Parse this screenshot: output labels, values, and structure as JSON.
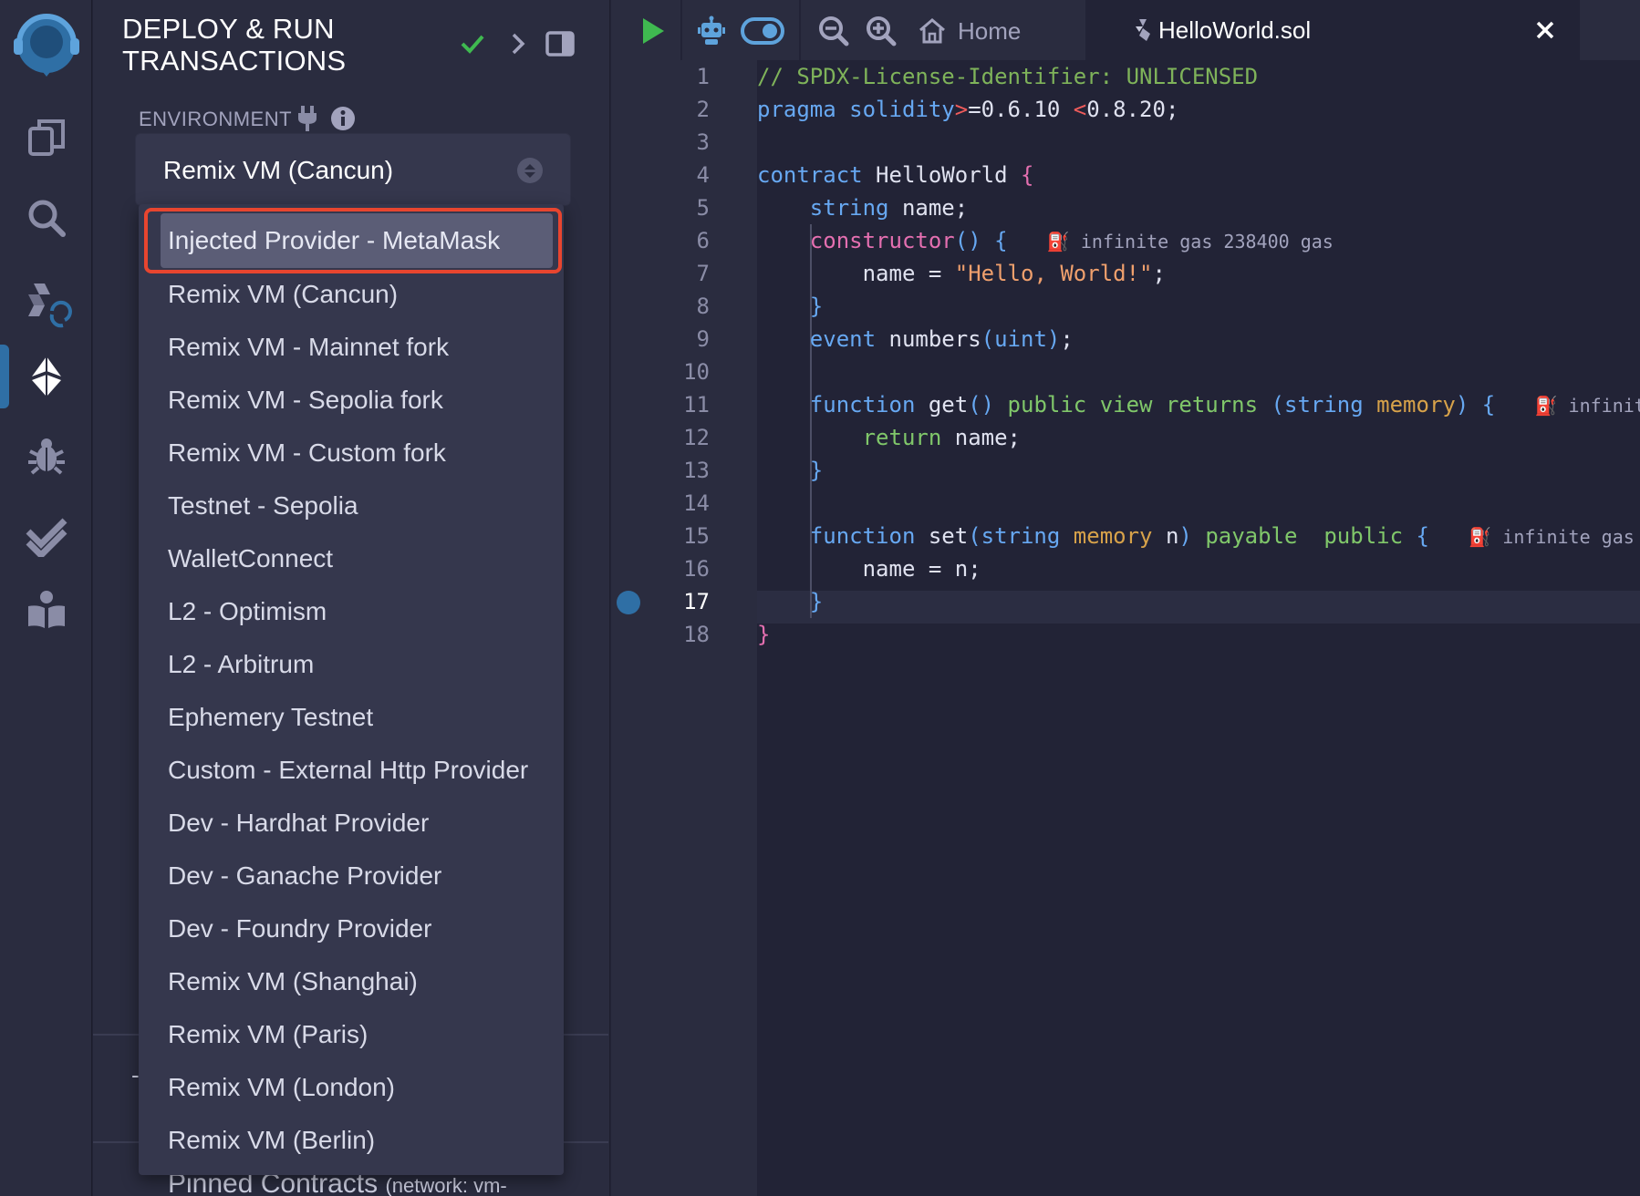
{
  "panel": {
    "title": "DEPLOY & RUN TRANSACTIONS",
    "environment_label": "ENVIRONMENT",
    "selected_environment": "Remix VM (Cancun)",
    "dash_text": "-",
    "pinned_label": "Pinned Contracts",
    "pinned_network": "(network: vm-"
  },
  "dropdown": {
    "options": [
      "Injected Provider - MetaMask",
      "Remix VM (Cancun)",
      "Remix VM - Mainnet fork",
      "Remix VM - Sepolia fork",
      "Remix VM - Custom fork",
      "Testnet - Sepolia",
      "WalletConnect",
      "L2 - Optimism",
      "L2 - Arbitrum",
      "Ephemery Testnet",
      "Custom - External Http Provider",
      "Dev - Hardhat Provider",
      "Dev - Ganache Provider",
      "Dev - Foundry Provider",
      "Remix VM (Shanghai)",
      "Remix VM (Paris)",
      "Remix VM (London)",
      "Remix VM (Berlin)"
    ],
    "highlighted_index": 0
  },
  "tabbar": {
    "home_label": "Home",
    "file_tab_label": "HelloWorld.sol"
  },
  "editor": {
    "line_numbers": [
      "1",
      "2",
      "3",
      "4",
      "5",
      "6",
      "7",
      "8",
      "9",
      "10",
      "11",
      "12",
      "13",
      "14",
      "15",
      "16",
      "17",
      "18"
    ],
    "current_line": "17",
    "gas_hints": {
      "line6": "infinite gas 238400 gas",
      "line11": "infinit",
      "line15": "infinite gas"
    }
  },
  "rail_icons": [
    "remix-logo-icon",
    "file-explorer-icon",
    "search-icon",
    "solidity-compiler-icon",
    "deploy-run-icon",
    "debugger-icon",
    "testing-icon",
    "learneth-icon"
  ],
  "colors": {
    "background": "#222336",
    "panel": "#2a2c3f",
    "accent_blue": "#2f6fa5",
    "highlight_border": "#e8452f",
    "run_green": "#3fb950"
  }
}
